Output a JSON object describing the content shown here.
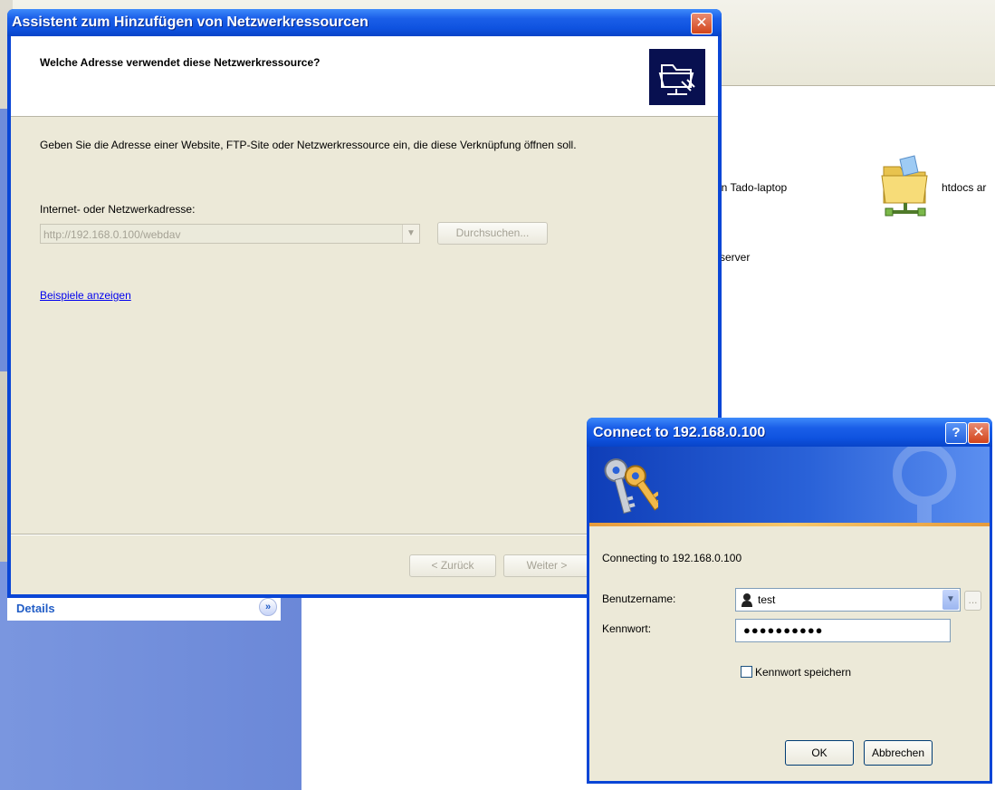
{
  "wizard": {
    "title": "Assistent zum Hinzufügen von Netzwerkressourcen",
    "close_symbol": "✕",
    "heading": "Welche Adresse verwendet diese Netzwerkressource?",
    "description": "Geben Sie die Adresse einer Website, FTP-Site oder Netzwerkressource ein, die diese Verknüpfung öffnen soll.",
    "address_label": "Internet- oder Netzwerkadresse:",
    "address_value": "http://192.168.0.100/webdav",
    "browse_label": "Durchsuchen...",
    "examples_link": "Beispiele anzeigen",
    "back_label": "< Zurück",
    "next_label": "Weiter >"
  },
  "background": {
    "resource_1": "an Tado-laptop",
    "resource_2": "htdocs ar",
    "resource_3": "server",
    "details_label": "Details",
    "details_toggle": "»"
  },
  "connect": {
    "title": "Connect to 192.168.0.100",
    "help_symbol": "?",
    "close_symbol": "✕",
    "connecting_text": "Connecting to 192.168.0.100",
    "username_label": "Benutzername:",
    "username_value": "test",
    "password_label": "Kennwort:",
    "password_value": "●●●●●●●●●●",
    "remember_label": "Kennwort speichern",
    "remember_checked": false,
    "more_symbol": "...",
    "ok_label": "OK",
    "cancel_label": "Abbrechen"
  },
  "colors": {
    "titlebar": "#0f53e0",
    "dialog_bg": "#ece9d8",
    "task_panel": "#6b88d8",
    "link": "#0000ee"
  }
}
